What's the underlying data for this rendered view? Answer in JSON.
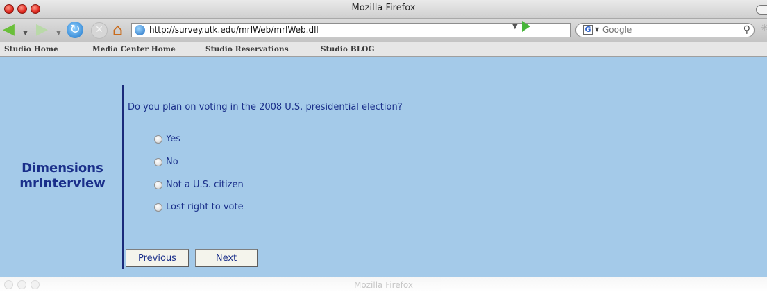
{
  "window": {
    "title": "Mozilla Firefox"
  },
  "toolbar": {
    "url": "http://survey.utk.edu/mrIWeb/mrIWeb.dll",
    "search_placeholder": "Google",
    "search_engine_letter": "G"
  },
  "bookmarks": [
    "Studio Home",
    "Media Center Home",
    "Studio Reservations",
    "Studio BLOG"
  ],
  "survey": {
    "brand_line1": "Dimensions",
    "brand_line2": "mrInterview",
    "question": "Do you plan on voting in the 2008 U.S. presidential election?",
    "options": [
      "Yes",
      "No",
      "Not a U.S. citizen",
      "Lost right to vote"
    ],
    "previous_label": "Previous",
    "next_label": "Next"
  },
  "reflection": {
    "title": "Mozilla Firefox"
  },
  "colors": {
    "content_bg": "#a4cae9",
    "text": "#1a2f8a"
  }
}
